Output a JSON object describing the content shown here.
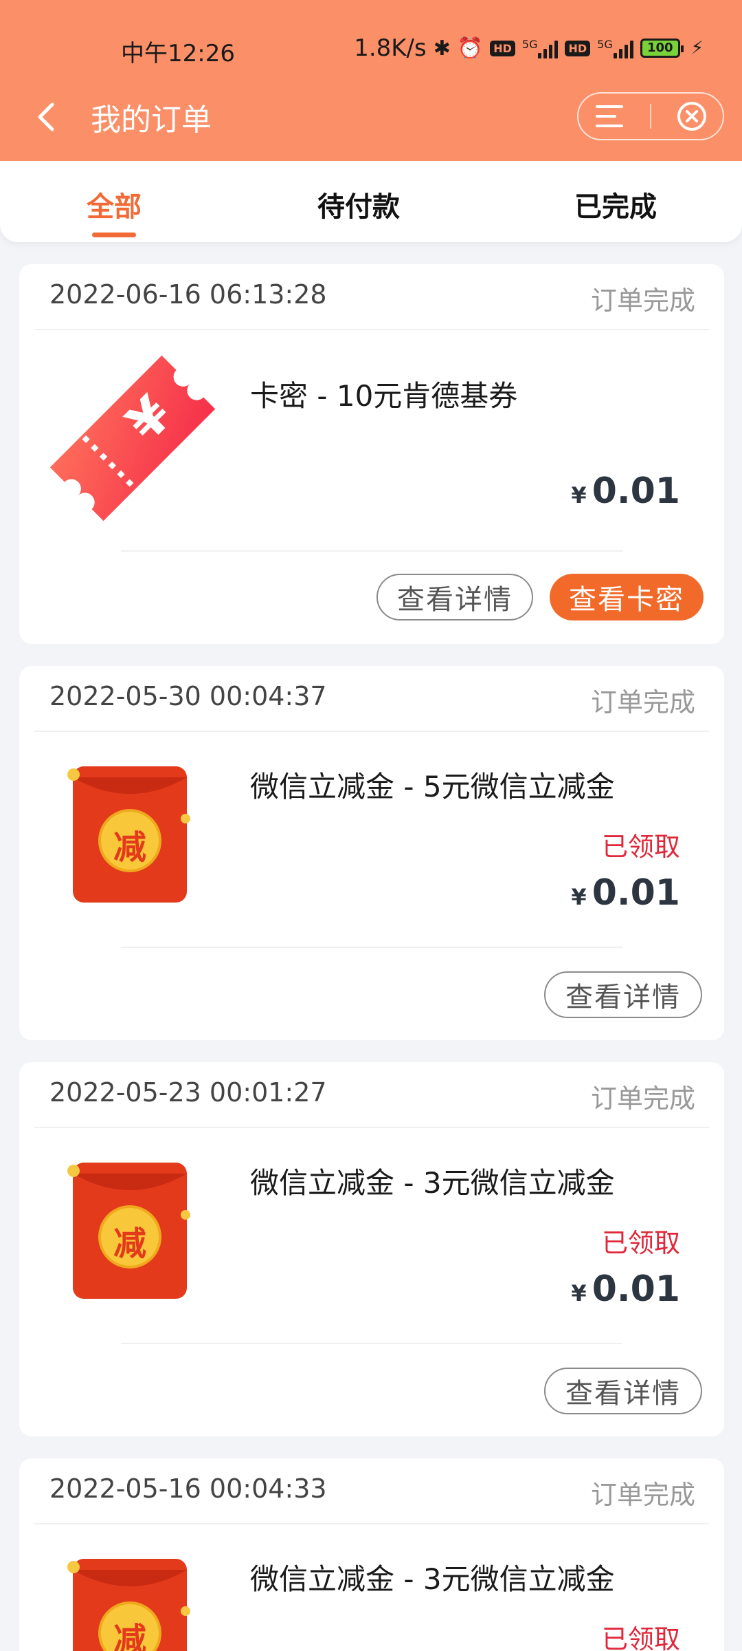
{
  "status_bar": {
    "time": "中午12:26",
    "net_speed": "1.8K/s",
    "hd1": "HD",
    "hd2": "HD",
    "net1": "5G",
    "net2": "5G",
    "battery": "100"
  },
  "nav": {
    "title": "我的订单"
  },
  "tabs": [
    {
      "label": "全部",
      "active": true
    },
    {
      "label": "待付款",
      "active": false
    },
    {
      "label": "已完成",
      "active": false
    }
  ],
  "orders": [
    {
      "time": "2022-06-16 06:13:28",
      "status": "订单完成",
      "title": "卡密 - 10元肯德基券",
      "currency": "¥",
      "price": "0.01",
      "buttons": [
        "查看详情",
        "查看卡密"
      ],
      "thumb": "ticket-icon"
    },
    {
      "time": "2022-05-30 00:04:37",
      "status": "订单完成",
      "title": "微信立减金 - 5元微信立减金",
      "claimed": "已领取",
      "currency": "¥",
      "price": "0.01",
      "buttons": [
        "查看详情"
      ],
      "thumb": "red-envelope-icon",
      "thumb_char": "减"
    },
    {
      "time": "2022-05-23 00:01:27",
      "status": "订单完成",
      "title": "微信立减金 - 3元微信立减金",
      "claimed": "已领取",
      "currency": "¥",
      "price": "0.01",
      "buttons": [
        "查看详情"
      ],
      "thumb": "red-envelope-icon",
      "thumb_char": "减"
    },
    {
      "time": "2022-05-16 00:04:33",
      "status": "订单完成",
      "title": "微信立减金 - 3元微信立减金",
      "claimed": "已领取",
      "thumb": "red-envelope-icon",
      "thumb_char": "减"
    }
  ],
  "colors": {
    "header": "#fb9068",
    "accent": "#f26a35",
    "claimed": "#e0283a"
  }
}
